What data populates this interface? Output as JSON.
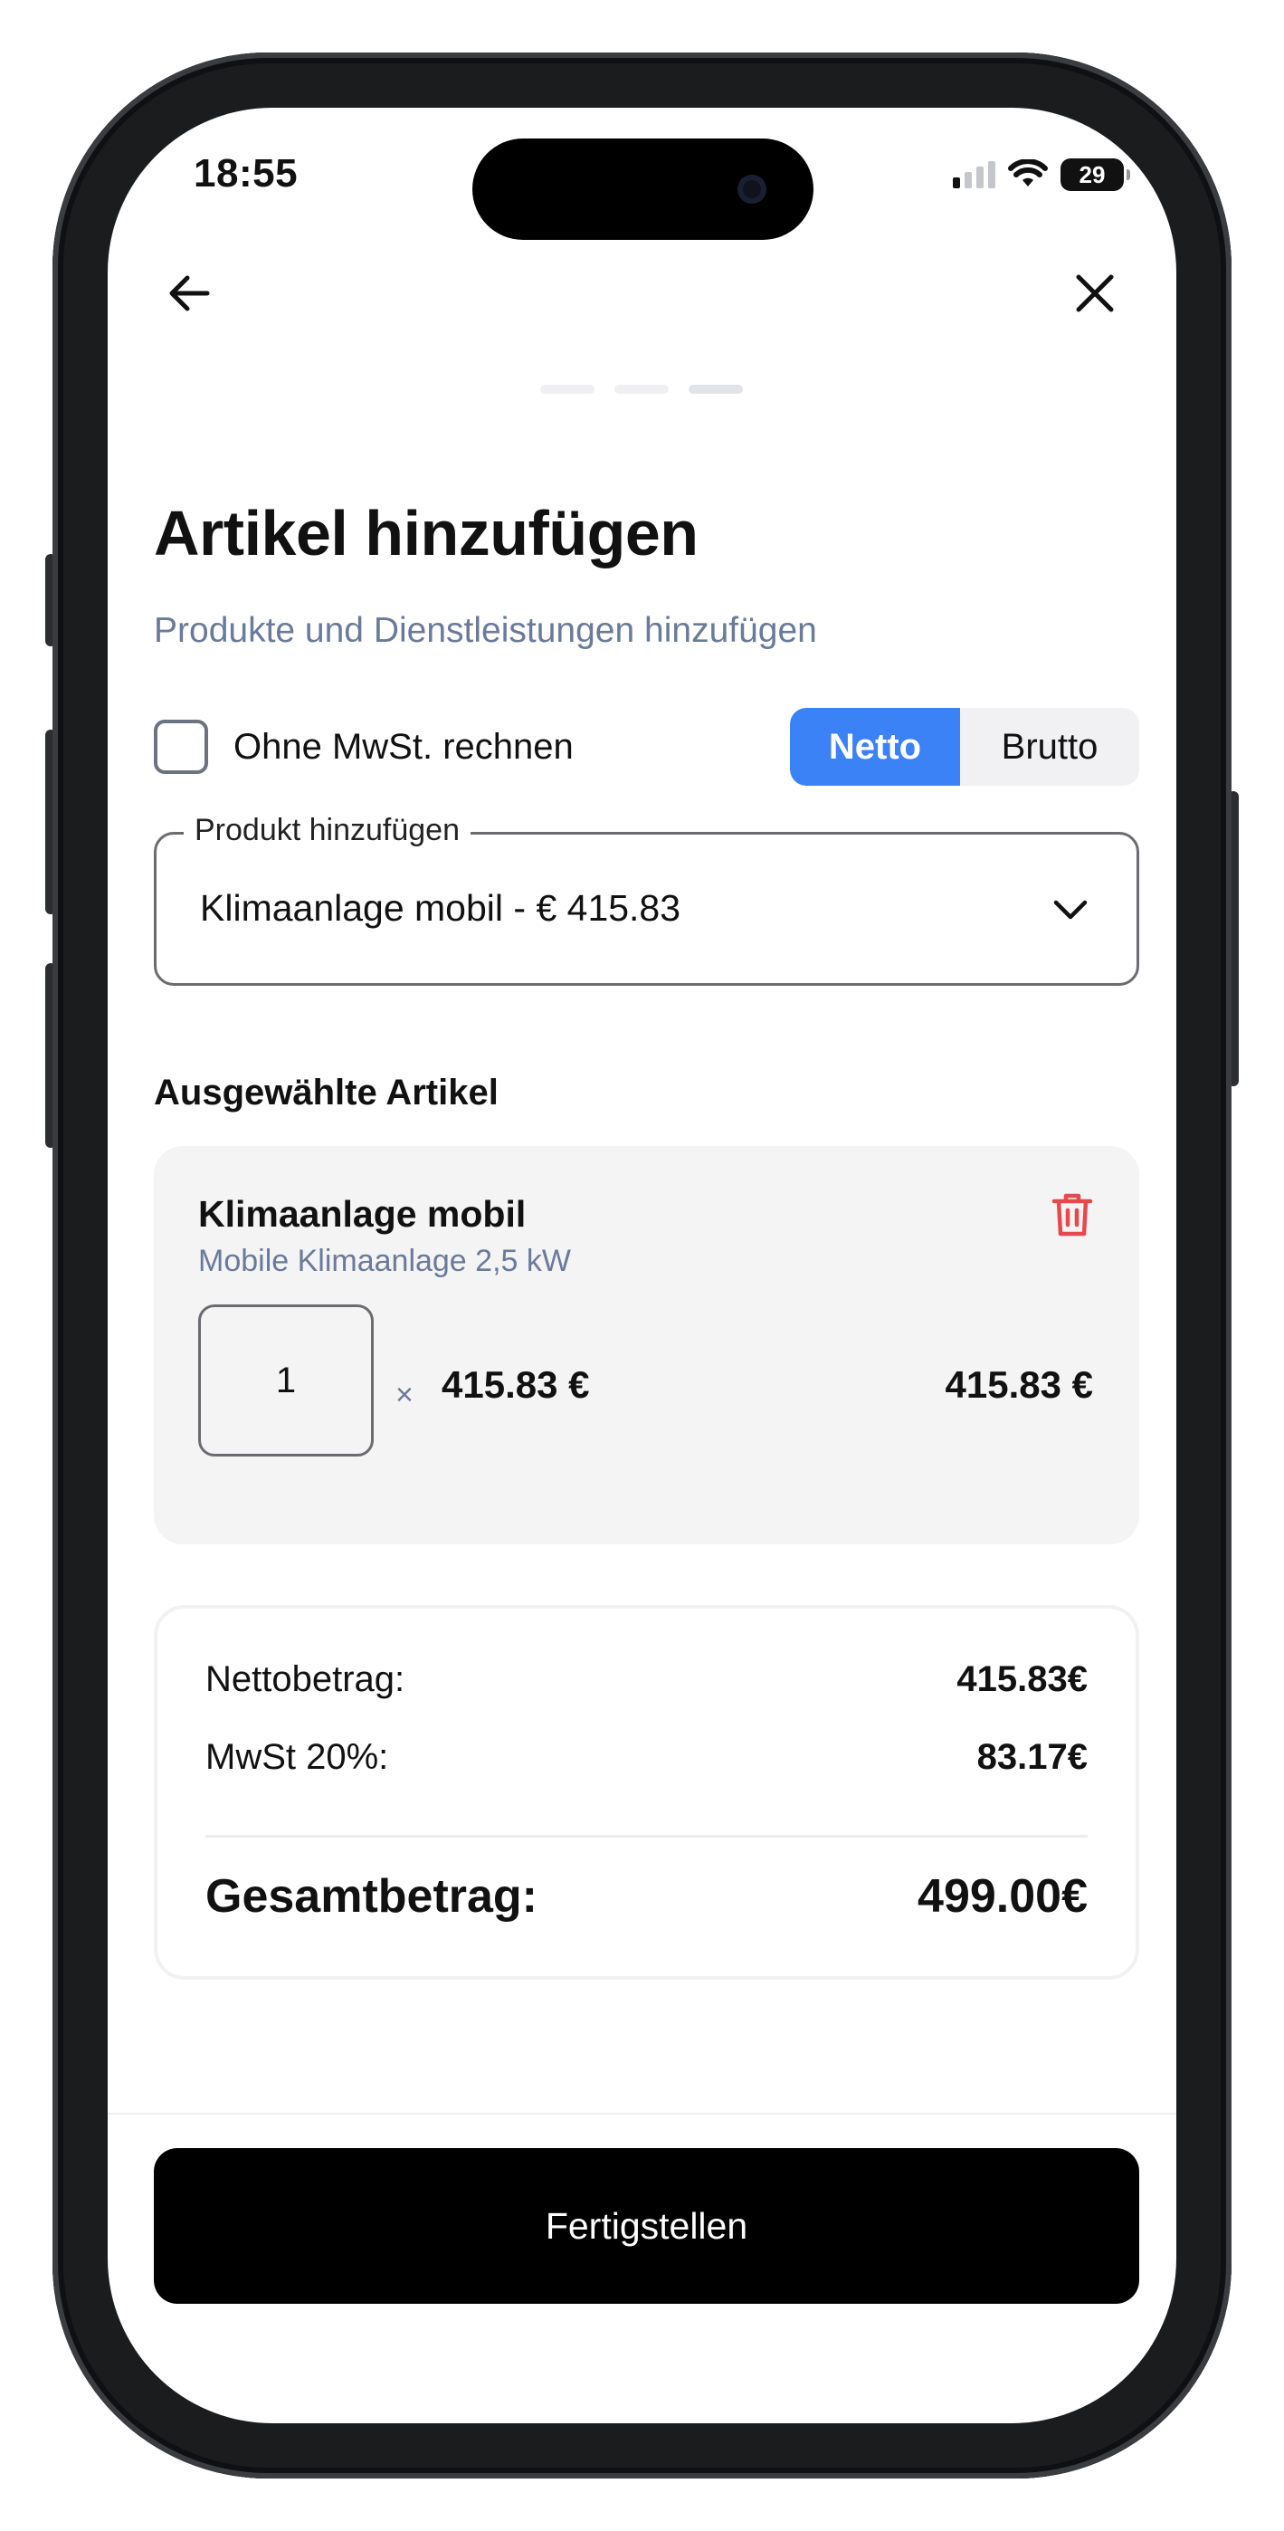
{
  "status_bar": {
    "time": "18:55",
    "battery": "29"
  },
  "progress": {
    "steps": 3,
    "current": 3
  },
  "header": {
    "title": "Artikel hinzufügen",
    "subtitle": "Produkte und Dienstleistungen hinzufügen"
  },
  "options": {
    "no_vat_label": "Ohne MwSt. rechnen",
    "no_vat_checked": false,
    "netto_label": "Netto",
    "brutto_label": "Brutto",
    "selected_mode": "Netto"
  },
  "product_select": {
    "legend": "Produkt hinzufügen",
    "value": "Klimaanlage mobil - € 415.83"
  },
  "selected_items": {
    "heading": "Ausgewählte Artikel",
    "items": [
      {
        "name": "Klimaanlage mobil",
        "description": "Mobile Klimaanlage 2,5 kW",
        "quantity": "1",
        "times": "×",
        "unit_price": "415.83 €",
        "total": "415.83 €"
      }
    ]
  },
  "summary": {
    "net_label": "Nettobetrag:",
    "net_value": "415.83€",
    "vat_label": "MwSt 20%:",
    "vat_value": "83.17€",
    "total_label": "Gesamtbetrag:",
    "total_value": "499.00€"
  },
  "footer": {
    "finish_label": "Fertigstellen"
  },
  "colors": {
    "accent": "#3b82f6",
    "danger": "#e5484d",
    "muted": "#6a7a99"
  }
}
